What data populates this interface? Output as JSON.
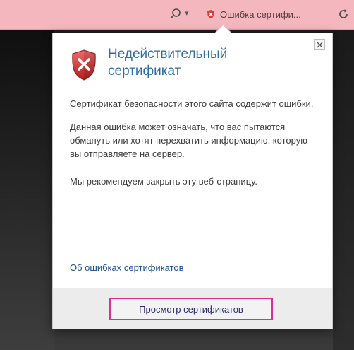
{
  "addressbar": {
    "search_dropdown": "▾",
    "cert_error_label": "Ошибка сертифи...",
    "accent_color": "#f4b7bd",
    "error_color": "#d83b3b"
  },
  "popup": {
    "title": "Недействительный сертификат",
    "paragraph1": "Сертификат безопасности этого сайта содержит ошибки.",
    "paragraph2": "Данная ошибка может означать, что вас пытаются обмануть или хотят перехватить информацию, которую вы отправляете на сервер.",
    "paragraph3": "Мы рекомендуем закрыть эту веб-страницу.",
    "link_label": "Об ошибках сертификатов",
    "view_cert_button_label": "Просмотр сертификатов",
    "close_icon": "close-icon",
    "shield_icon": "shield-error-icon",
    "highlight_color": "#e02d8f"
  }
}
